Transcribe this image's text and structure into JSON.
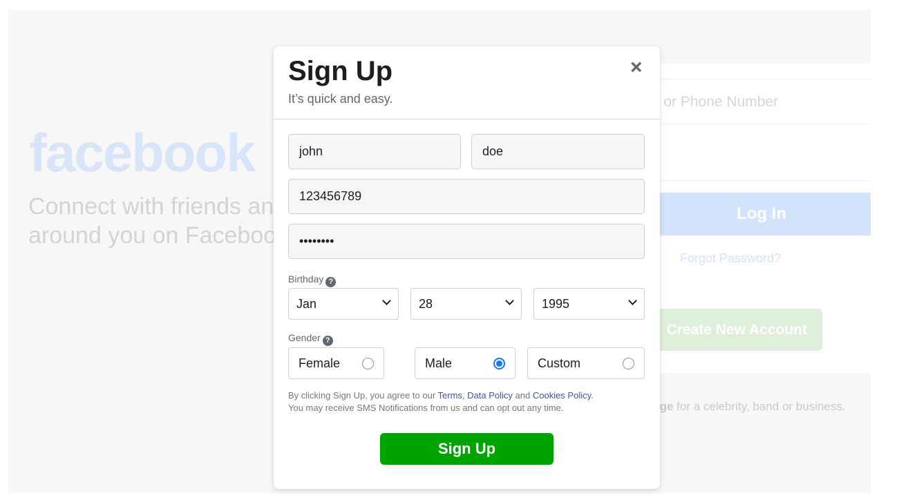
{
  "background": {
    "logo": "facebook",
    "tagline": "Connect with friends and the world around you on Facebook.",
    "email_placeholder": "Email or Phone Number",
    "login_label": "Log In",
    "forgot_label": "Forgot Password?",
    "create_label": "Create New Account",
    "page_text_bold": "Create a Page",
    "page_text": " for a celebrity, band or business."
  },
  "modal": {
    "title": "Sign Up",
    "subtitle": "It’s quick and easy.",
    "close_icon": "×",
    "first_name": "john",
    "last_name": "doe",
    "mobile": "123456789",
    "password": "••••••••",
    "birthday_label": "Birthday",
    "birthday": {
      "month": "Jan",
      "day": "28",
      "year": "1995"
    },
    "gender_label": "Gender",
    "help_icon": "?",
    "genders": [
      {
        "label": "Female",
        "checked": false
      },
      {
        "label": "Male",
        "checked": true
      },
      {
        "label": "Custom",
        "checked": false
      }
    ],
    "terms": {
      "t1": "By clicking Sign Up, you agree to our ",
      "terms": "Terms",
      "t2": ", ",
      "data_policy": "Data Policy",
      "t3": " and ",
      "cookies": "Cookies Policy",
      "t4": ".",
      "line2": "You may receive SMS Notifications from us and can opt out any time."
    },
    "submit_label": "Sign Up",
    "accent": "#1877f2",
    "submit_color": "#00a400"
  }
}
